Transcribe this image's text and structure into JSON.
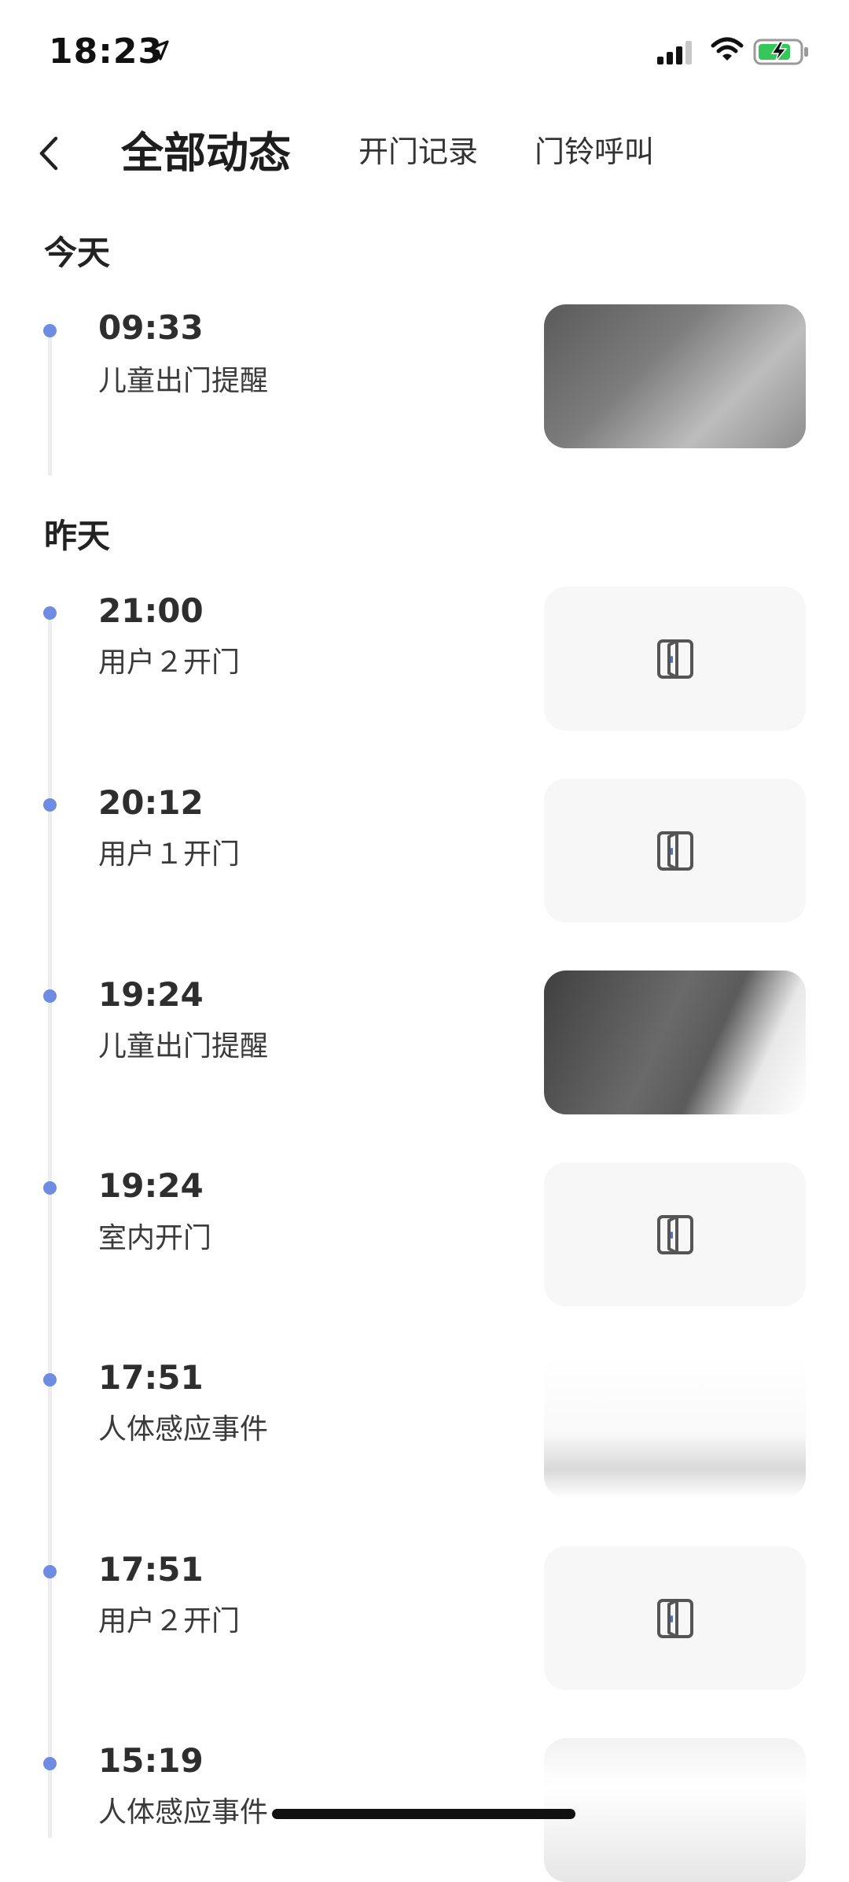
{
  "status_bar": {
    "time": "18:23"
  },
  "nav": {
    "title": "全部动态",
    "tabs": [
      {
        "label": "开门记录"
      },
      {
        "label": "门铃呼叫"
      }
    ]
  },
  "sections": [
    {
      "label": "今天",
      "events": [
        {
          "time": "09:33",
          "desc": "儿童出门提醒",
          "thumb": "camera-snapshot"
        }
      ]
    },
    {
      "label": "昨天",
      "events": [
        {
          "time": "21:00",
          "desc": "用户２开门",
          "thumb": "door-icon"
        },
        {
          "time": "20:12",
          "desc": "用户１开门",
          "thumb": "door-icon"
        },
        {
          "time": "19:24",
          "desc": "儿童出门提醒",
          "thumb": "camera-snapshot"
        },
        {
          "time": "19:24",
          "desc": "室内开门",
          "thumb": "door-icon"
        },
        {
          "time": "17:51",
          "desc": "人体感应事件",
          "thumb": "camera-snapshot"
        },
        {
          "time": "17:51",
          "desc": "用户２开门",
          "thumb": "door-icon"
        },
        {
          "time": "15:19",
          "desc": "人体感应事件",
          "thumb": "camera-snapshot"
        }
      ]
    }
  ],
  "colors": {
    "accent_dot": "#6f8be2",
    "timeline_line": "#ececf1",
    "thumb_bg": "#f7f7f7"
  }
}
